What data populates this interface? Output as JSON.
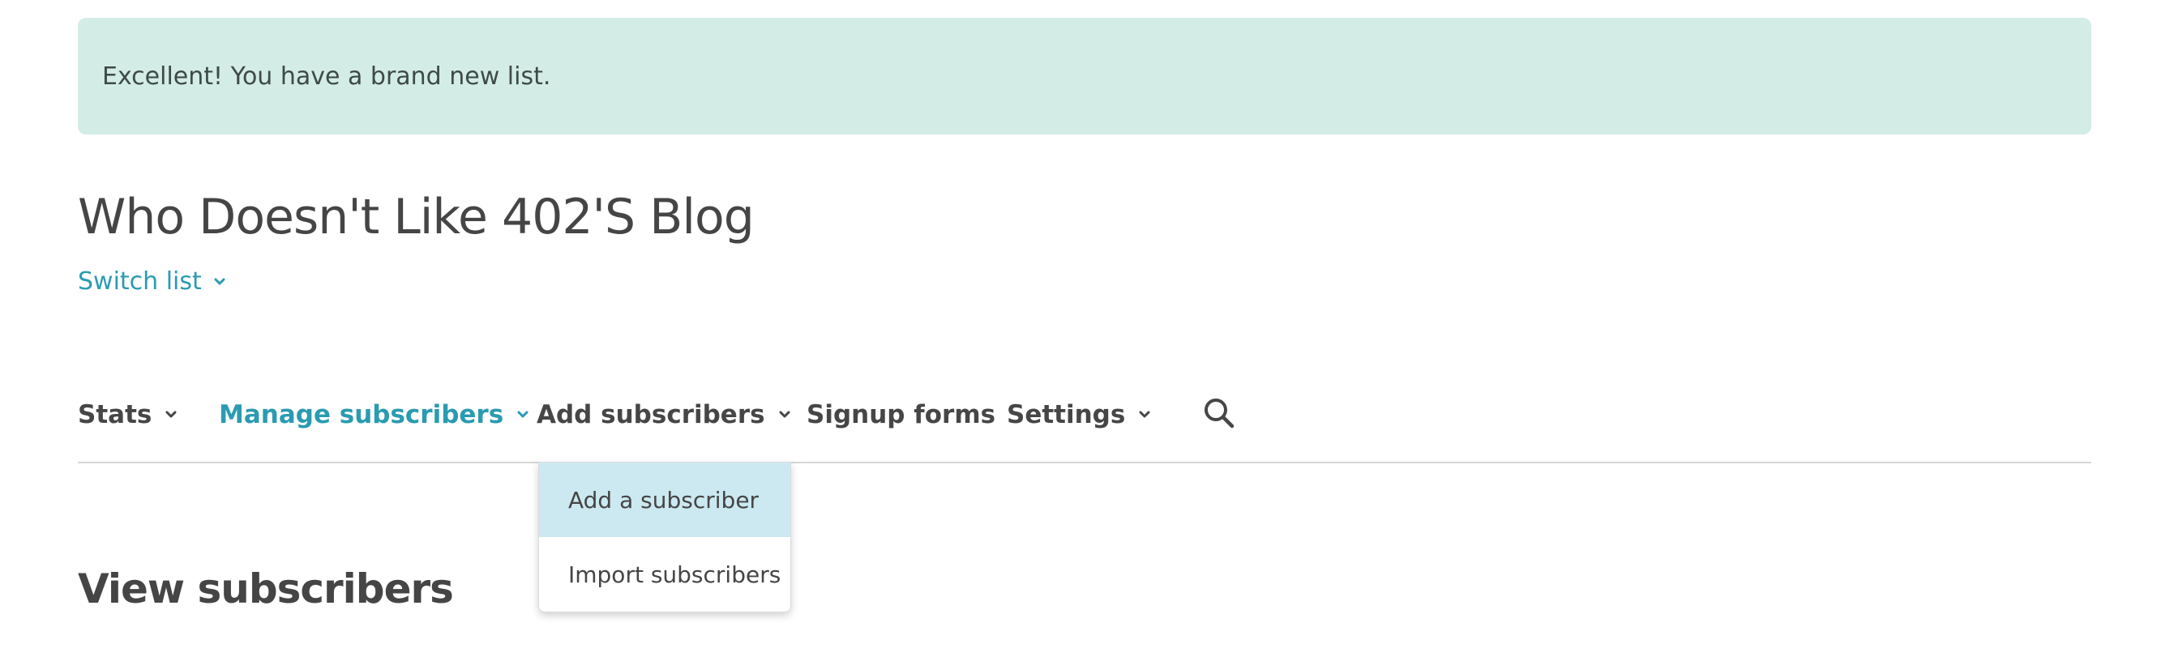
{
  "banner": {
    "message": "Excellent! You have a brand new list."
  },
  "list": {
    "title": "Who Doesn't Like 402'S Blog",
    "switch_label": "Switch list"
  },
  "nav": {
    "items": [
      {
        "label": "Stats",
        "has_dropdown": true,
        "active": false
      },
      {
        "label": "Manage subscribers",
        "has_dropdown": true,
        "active": true
      },
      {
        "label": "Add subscribers",
        "has_dropdown": true,
        "active": false
      },
      {
        "label": "Signup forms",
        "has_dropdown": false,
        "active": false
      },
      {
        "label": "Settings",
        "has_dropdown": true,
        "active": false
      }
    ],
    "search_icon": "search-icon"
  },
  "dropdown": {
    "items": [
      {
        "label": "Add a subscriber",
        "highlighted": true
      },
      {
        "label": "Import subscribers",
        "highlighted": false
      }
    ]
  },
  "section": {
    "title": "View subscribers"
  },
  "colors": {
    "accent": "#2a9bb1",
    "banner_bg": "#d3ede6",
    "text": "#454545",
    "highlight_bg": "#cce9f1",
    "divider": "#d6d6d6"
  }
}
